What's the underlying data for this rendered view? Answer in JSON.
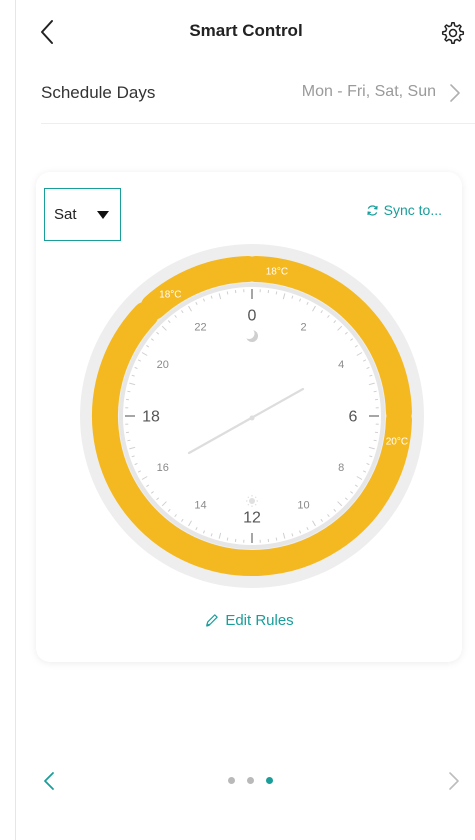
{
  "header": {
    "title": "Smart Control",
    "back_icon": "chevron-left-icon",
    "settings_icon": "gear-icon"
  },
  "schedule": {
    "label": "Schedule Days",
    "value": "Mon - Fri, Sat, Sun"
  },
  "card": {
    "day_select": "Sat",
    "sync_label": "Sync to...",
    "edit_rules_label": "Edit Rules"
  },
  "dial": {
    "hour_labels_major": [
      "0",
      "6",
      "12",
      "18"
    ],
    "hour_labels_minor": [
      "2",
      "4",
      "8",
      "10",
      "14",
      "16",
      "20",
      "22"
    ],
    "segments": [
      {
        "label": "18°C",
        "start_hour": 21.2,
        "end_hour": 23.9
      },
      {
        "label": "18°C",
        "start_hour": 0.1,
        "end_hour": 5.9
      },
      {
        "label": "20°C",
        "start_hour": 6.1,
        "end_hour": 20.9
      }
    ]
  },
  "pager": {
    "page_count": 3,
    "active_page": 3
  },
  "colors": {
    "accent": "#1a9e9a",
    "segment": "#f4b820",
    "ring": "#eeeeee"
  }
}
